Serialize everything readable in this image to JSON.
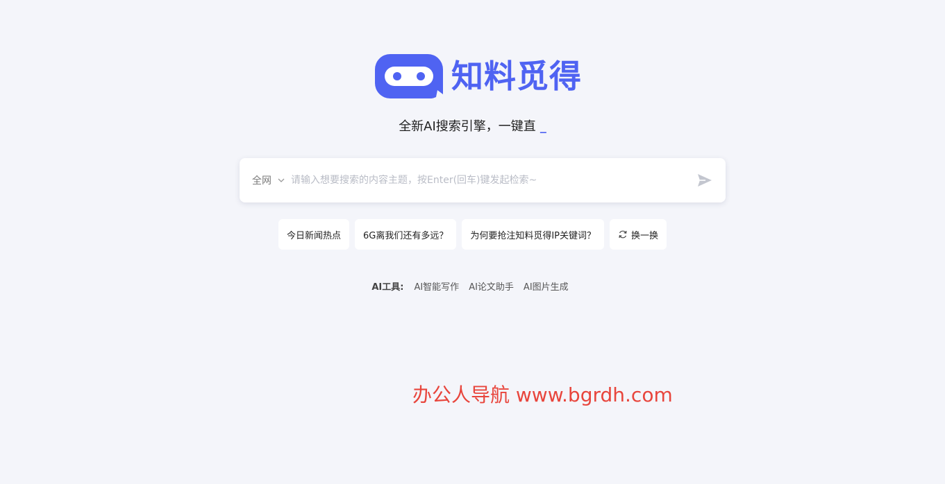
{
  "brand": {
    "name": "知料觅得",
    "color": "#4f63f2"
  },
  "tagline": {
    "text": "全新AI搜索引擎，一键直",
    "cursor": "_"
  },
  "search": {
    "scope_label": "全网",
    "placeholder": "请输入想要搜索的内容主题，按Enter(回车)键发起检索~",
    "value": ""
  },
  "suggestions": [
    {
      "label": "今日新闻热点"
    },
    {
      "label": "6G离我们还有多远？"
    },
    {
      "label": "为何要抢注知料觅得IP关键词？"
    }
  ],
  "refresh": {
    "label": "换一换"
  },
  "tools": {
    "label": "AI工具:",
    "items": [
      {
        "label": "AI智能写作"
      },
      {
        "label": "AI论文助手"
      },
      {
        "label": "AI图片生成"
      }
    ]
  },
  "watermark": {
    "text": "办公人导航 www.bgrdh.com",
    "color": "#e8453c"
  },
  "icons": {
    "logo": "chat-bubble-eyes-icon",
    "scope": "chevron-down-icon",
    "send": "send-icon",
    "refresh": "refresh-icon"
  }
}
